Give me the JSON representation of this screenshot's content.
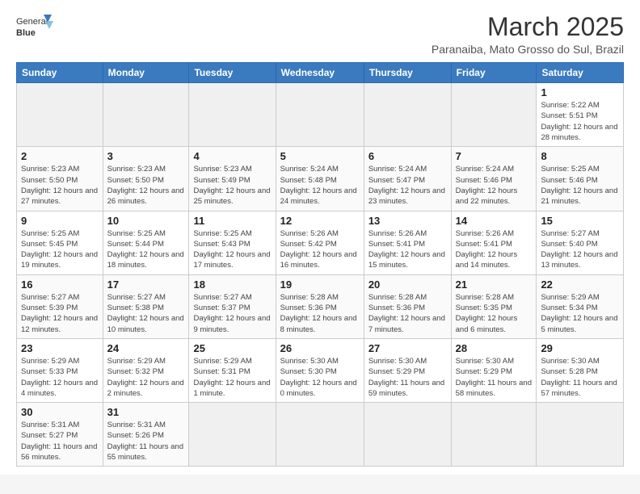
{
  "logo": {
    "text_normal": "General",
    "text_bold": "Blue"
  },
  "header": {
    "month_title": "March 2025",
    "subtitle": "Paranaiba, Mato Grosso do Sul, Brazil"
  },
  "days_of_week": [
    "Sunday",
    "Monday",
    "Tuesday",
    "Wednesday",
    "Thursday",
    "Friday",
    "Saturday"
  ],
  "weeks": [
    [
      {
        "day": "",
        "info": ""
      },
      {
        "day": "",
        "info": ""
      },
      {
        "day": "",
        "info": ""
      },
      {
        "day": "",
        "info": ""
      },
      {
        "day": "",
        "info": ""
      },
      {
        "day": "",
        "info": ""
      },
      {
        "day": "1",
        "info": "Sunrise: 5:22 AM\nSunset: 5:51 PM\nDaylight: 12 hours and 28 minutes."
      }
    ],
    [
      {
        "day": "2",
        "info": "Sunrise: 5:23 AM\nSunset: 5:50 PM\nDaylight: 12 hours and 27 minutes."
      },
      {
        "day": "3",
        "info": "Sunrise: 5:23 AM\nSunset: 5:50 PM\nDaylight: 12 hours and 26 minutes."
      },
      {
        "day": "4",
        "info": "Sunrise: 5:23 AM\nSunset: 5:49 PM\nDaylight: 12 hours and 25 minutes."
      },
      {
        "day": "5",
        "info": "Sunrise: 5:24 AM\nSunset: 5:48 PM\nDaylight: 12 hours and 24 minutes."
      },
      {
        "day": "6",
        "info": "Sunrise: 5:24 AM\nSunset: 5:47 PM\nDaylight: 12 hours and 23 minutes."
      },
      {
        "day": "7",
        "info": "Sunrise: 5:24 AM\nSunset: 5:46 PM\nDaylight: 12 hours and 22 minutes."
      },
      {
        "day": "8",
        "info": "Sunrise: 5:25 AM\nSunset: 5:46 PM\nDaylight: 12 hours and 21 minutes."
      }
    ],
    [
      {
        "day": "9",
        "info": "Sunrise: 5:25 AM\nSunset: 5:45 PM\nDaylight: 12 hours and 19 minutes."
      },
      {
        "day": "10",
        "info": "Sunrise: 5:25 AM\nSunset: 5:44 PM\nDaylight: 12 hours and 18 minutes."
      },
      {
        "day": "11",
        "info": "Sunrise: 5:25 AM\nSunset: 5:43 PM\nDaylight: 12 hours and 17 minutes."
      },
      {
        "day": "12",
        "info": "Sunrise: 5:26 AM\nSunset: 5:42 PM\nDaylight: 12 hours and 16 minutes."
      },
      {
        "day": "13",
        "info": "Sunrise: 5:26 AM\nSunset: 5:41 PM\nDaylight: 12 hours and 15 minutes."
      },
      {
        "day": "14",
        "info": "Sunrise: 5:26 AM\nSunset: 5:41 PM\nDaylight: 12 hours and 14 minutes."
      },
      {
        "day": "15",
        "info": "Sunrise: 5:27 AM\nSunset: 5:40 PM\nDaylight: 12 hours and 13 minutes."
      }
    ],
    [
      {
        "day": "16",
        "info": "Sunrise: 5:27 AM\nSunset: 5:39 PM\nDaylight: 12 hours and 12 minutes."
      },
      {
        "day": "17",
        "info": "Sunrise: 5:27 AM\nSunset: 5:38 PM\nDaylight: 12 hours and 10 minutes."
      },
      {
        "day": "18",
        "info": "Sunrise: 5:27 AM\nSunset: 5:37 PM\nDaylight: 12 hours and 9 minutes."
      },
      {
        "day": "19",
        "info": "Sunrise: 5:28 AM\nSunset: 5:36 PM\nDaylight: 12 hours and 8 minutes."
      },
      {
        "day": "20",
        "info": "Sunrise: 5:28 AM\nSunset: 5:36 PM\nDaylight: 12 hours and 7 minutes."
      },
      {
        "day": "21",
        "info": "Sunrise: 5:28 AM\nSunset: 5:35 PM\nDaylight: 12 hours and 6 minutes."
      },
      {
        "day": "22",
        "info": "Sunrise: 5:29 AM\nSunset: 5:34 PM\nDaylight: 12 hours and 5 minutes."
      }
    ],
    [
      {
        "day": "23",
        "info": "Sunrise: 5:29 AM\nSunset: 5:33 PM\nDaylight: 12 hours and 4 minutes."
      },
      {
        "day": "24",
        "info": "Sunrise: 5:29 AM\nSunset: 5:32 PM\nDaylight: 12 hours and 2 minutes."
      },
      {
        "day": "25",
        "info": "Sunrise: 5:29 AM\nSunset: 5:31 PM\nDaylight: 12 hours and 1 minute."
      },
      {
        "day": "26",
        "info": "Sunrise: 5:30 AM\nSunset: 5:30 PM\nDaylight: 12 hours and 0 minutes."
      },
      {
        "day": "27",
        "info": "Sunrise: 5:30 AM\nSunset: 5:29 PM\nDaylight: 11 hours and 59 minutes."
      },
      {
        "day": "28",
        "info": "Sunrise: 5:30 AM\nSunset: 5:29 PM\nDaylight: 11 hours and 58 minutes."
      },
      {
        "day": "29",
        "info": "Sunrise: 5:30 AM\nSunset: 5:28 PM\nDaylight: 11 hours and 57 minutes."
      }
    ],
    [
      {
        "day": "30",
        "info": "Sunrise: 5:31 AM\nSunset: 5:27 PM\nDaylight: 11 hours and 56 minutes."
      },
      {
        "day": "31",
        "info": "Sunrise: 5:31 AM\nSunset: 5:26 PM\nDaylight: 11 hours and 55 minutes."
      },
      {
        "day": "",
        "info": ""
      },
      {
        "day": "",
        "info": ""
      },
      {
        "day": "",
        "info": ""
      },
      {
        "day": "",
        "info": ""
      },
      {
        "day": "",
        "info": ""
      }
    ]
  ]
}
